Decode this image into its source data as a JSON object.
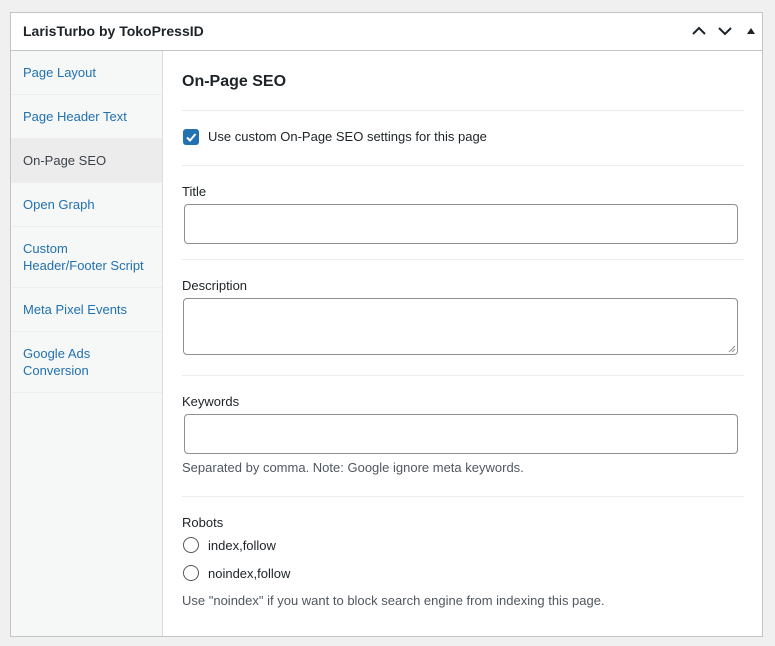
{
  "metabox": {
    "title": "LarisTurbo by TokoPressID",
    "controls": {
      "move_up_icon": "chevron-up-icon",
      "move_down_icon": "chevron-down-icon",
      "toggle_icon": "triangle-up-icon"
    }
  },
  "sidebar": {
    "items": [
      {
        "label": "Page Layout"
      },
      {
        "label": "Page Header Text"
      },
      {
        "label": "On-Page SEO"
      },
      {
        "label": "Open Graph"
      },
      {
        "label": "Custom Header/Footer Script"
      },
      {
        "label": "Meta Pixel Events"
      },
      {
        "label": "Google Ads Conversion"
      }
    ],
    "active_index": 2
  },
  "main": {
    "title": "On-Page SEO",
    "use_custom": {
      "label": "Use custom On-Page SEO settings for this page",
      "checked": true
    },
    "title_field": {
      "label": "Title",
      "value": ""
    },
    "description_field": {
      "label": "Description",
      "value": ""
    },
    "keywords_field": {
      "label": "Keywords",
      "value": "",
      "help": "Separated by comma. Note: Google ignore meta keywords."
    },
    "robots": {
      "label": "Robots",
      "options": [
        {
          "label": "index,follow",
          "selected": false
        },
        {
          "label": "noindex,follow",
          "selected": false
        }
      ],
      "help": "Use \"noindex\" if you want to block search engine from indexing this page."
    }
  },
  "colors": {
    "accent": "#2271b1",
    "border": "#c3c4c7",
    "text": "#1d2327",
    "muted": "#50575e"
  }
}
